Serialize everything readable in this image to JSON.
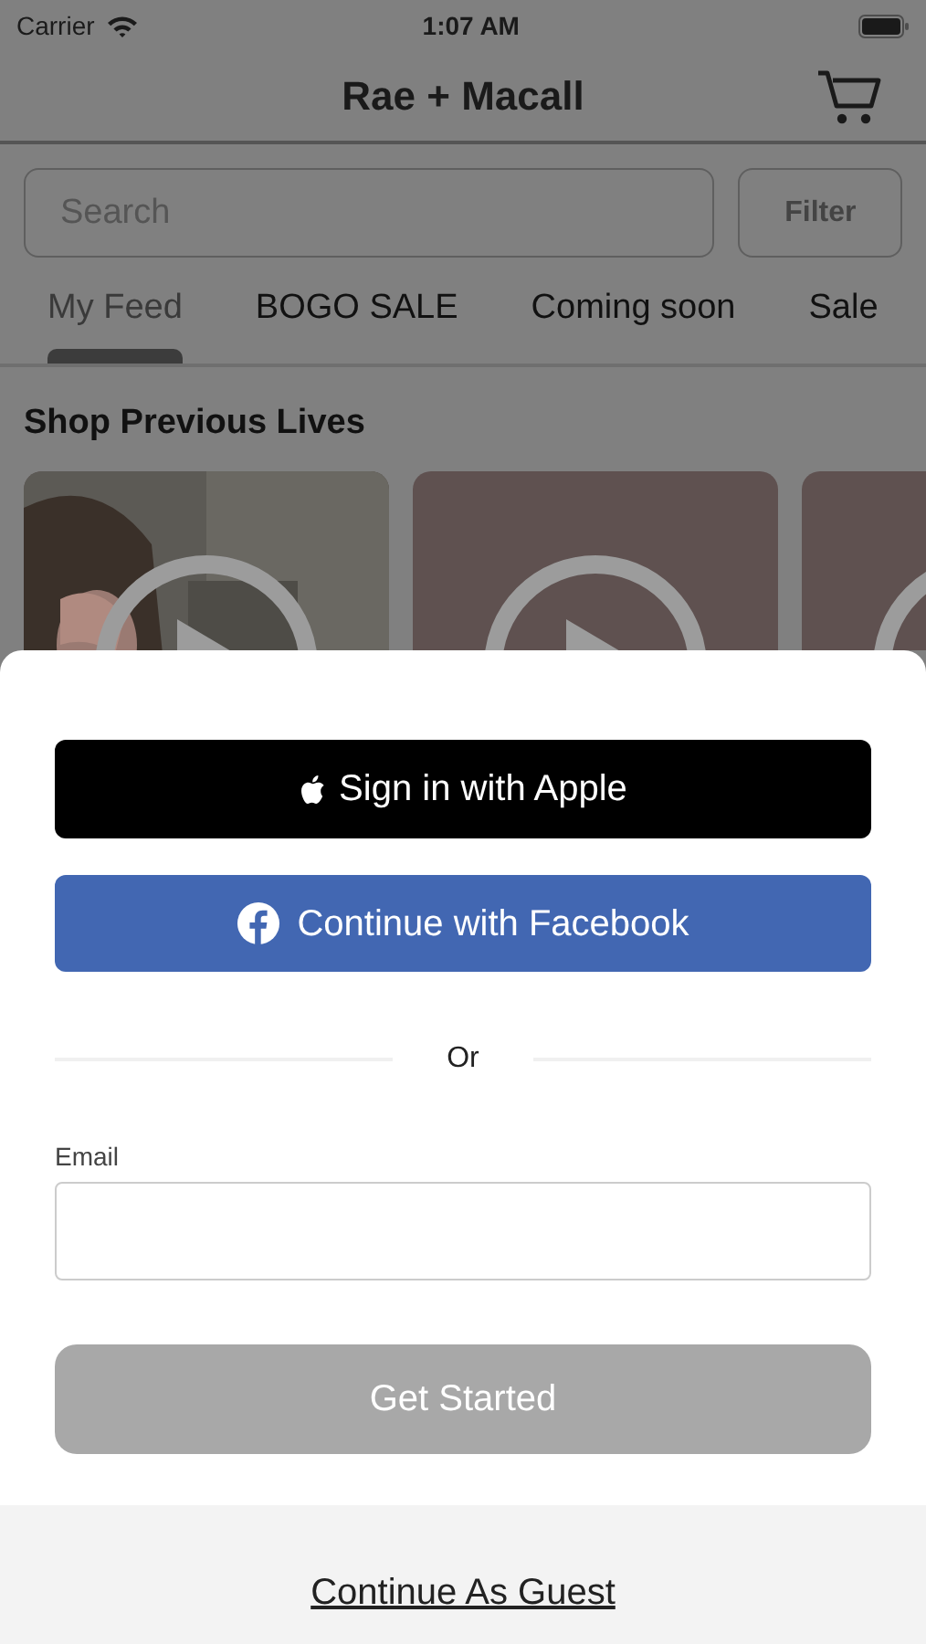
{
  "status_bar": {
    "carrier": "Carrier",
    "time": "1:07 AM"
  },
  "header": {
    "title": "Rae + Macall"
  },
  "search": {
    "placeholder": "Search"
  },
  "filter_button": "Filter",
  "tabs": [
    {
      "label": "My Feed",
      "selected": true
    },
    {
      "label": "BOGO SALE",
      "selected": false
    },
    {
      "label": "Coming soon",
      "selected": false
    },
    {
      "label": "Sale",
      "selected": false
    }
  ],
  "section_title": "Shop Previous Lives",
  "videos": [
    {
      "kind": "picture"
    },
    {
      "kind": "plain"
    },
    {
      "kind": "plain"
    }
  ],
  "sheet": {
    "apple_button": "Sign in with Apple",
    "facebook_button": "Continue with Facebook",
    "divider_text": "Or",
    "email_label": "Email",
    "submit": {
      "label": "Get Started",
      "disabled": true
    },
    "guest_link": "Continue As Guest"
  }
}
